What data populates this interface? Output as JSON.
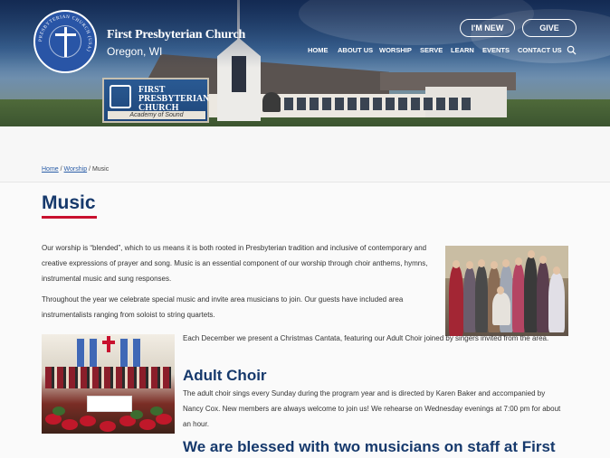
{
  "header": {
    "church_name": "First Presbyterian Church",
    "location": "Oregon, WI",
    "logo_ring_text": "PRESBYTERIAN CHURCH (USA)",
    "sign_text": "FIRST PRESBYTERIAN CHURCH",
    "sign_subtext": "Academy of Sound",
    "buttons": {
      "new": "I'M NEW",
      "give": "GIVE"
    },
    "nav": [
      "HOME",
      "ABOUT US",
      "WORSHIP",
      "SERVE",
      "LEARN",
      "EVENTS",
      "CONTACT US"
    ]
  },
  "breadcrumb": {
    "home": "Home",
    "sep1": "/",
    "worship": "Worship",
    "sep2": "/",
    "current": "Music"
  },
  "page": {
    "title": "Music",
    "p1": "Our worship is “blended”, which to us means it is both rooted in Presbyterian tradition and inclusive of contemporary and creative expressions of prayer and song. Music is an essential component of our worship through choir anthems, hymns, instrumental music and sung responses.",
    "p2": "Throughout the year we celebrate special music and invite area musicians to join. Our guests have included area instrumentalists ranging from soloist to string quartets.",
    "p3": "Each December we present a Christmas Cantata, featuring our Adult Choir joined by singers invited from the area.",
    "h2_choir": "Adult Choir",
    "p4": "The adult choir sings every Sunday during the program year and is directed by Karen Baker and accompanied by Nancy Cox. New members are always welcome to join us! We rehearse on Wednesday evenings at 7:00 pm for about an hour.",
    "h2_musicians": "We are blessed with two musicians on staff at First"
  },
  "colors": {
    "navy": "#16396c",
    "accent_red": "#c8102e",
    "link": "#2b5ea8"
  },
  "icons": {
    "search": "search-icon"
  }
}
